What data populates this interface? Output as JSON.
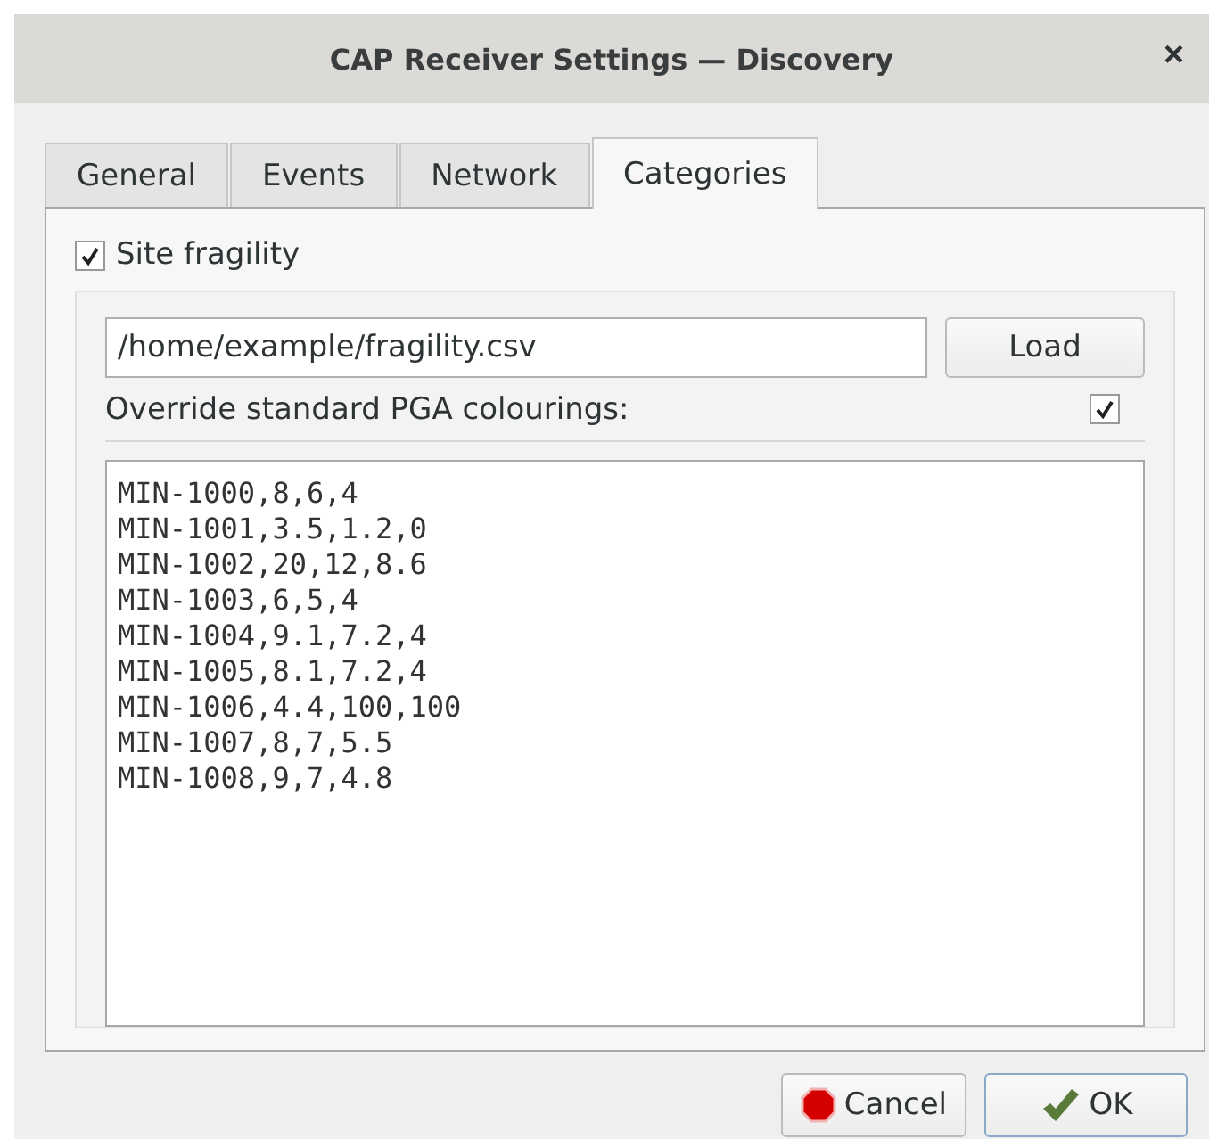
{
  "window": {
    "title": "CAP Receiver Settings — Discovery",
    "close": "×"
  },
  "tabs": [
    {
      "label": "General",
      "selected": false
    },
    {
      "label": "Events",
      "selected": false
    },
    {
      "label": "Network",
      "selected": false
    },
    {
      "label": "Categories",
      "selected": true
    }
  ],
  "site_fragility": {
    "label": "Site fragility",
    "checked": true
  },
  "file": {
    "value": "/home/example/fragility.csv",
    "button": "Load"
  },
  "override": {
    "label": "Override standard PGA colourings:",
    "checked": true
  },
  "lines": [
    "MIN-1000,8,6,4",
    "MIN-1001,3.5,1.2,0",
    "MIN-1002,20,12,8.6",
    "MIN-1003,6,5,4",
    "MIN-1004,9.1,7.2,4",
    "MIN-1005,8.1,7.2,4",
    "MIN-1006,4.4,100,100",
    "MIN-1007,8,7,5.5",
    "MIN-1008,9,7,4.8"
  ],
  "buttons": [
    {
      "kind": "cancel",
      "label": "Cancel"
    },
    {
      "kind": "ok",
      "label": "OK"
    }
  ]
}
